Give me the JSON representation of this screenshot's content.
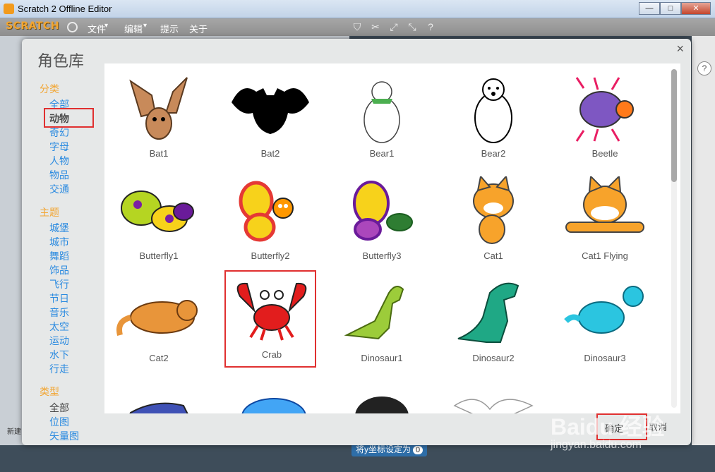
{
  "window": {
    "title": "Scratch 2 Offline Editor"
  },
  "menubar": {
    "logo": "SCRATCH",
    "items": [
      "文件",
      "编辑",
      "提示",
      "关于"
    ]
  },
  "dialog": {
    "title": "角色库",
    "close": "×",
    "category_heading": "分类",
    "categories": [
      "全部",
      "动物",
      "奇幻",
      "字母",
      "人物",
      "物品",
      "交通"
    ],
    "theme_heading": "主题",
    "themes": [
      "城堡",
      "城市",
      "舞蹈",
      "饰品",
      "飞行",
      "节日",
      "音乐",
      "太空",
      "运动",
      "水下",
      "行走"
    ],
    "type_heading": "类型",
    "types": [
      "全部",
      "位图",
      "矢量图"
    ],
    "sprites": [
      {
        "name": "Bat1"
      },
      {
        "name": "Bat2"
      },
      {
        "name": "Bear1"
      },
      {
        "name": "Bear2"
      },
      {
        "name": "Beetle"
      },
      {
        "name": "Butterfly1"
      },
      {
        "name": "Butterfly2"
      },
      {
        "name": "Butterfly3"
      },
      {
        "name": "Cat1"
      },
      {
        "name": "Cat1 Flying"
      },
      {
        "name": "Cat2"
      },
      {
        "name": "Crab"
      },
      {
        "name": "Dinosaur1"
      },
      {
        "name": "Dinosaur2"
      },
      {
        "name": "Dinosaur3"
      }
    ],
    "ok_label": "确定",
    "cancel_label": "取消"
  },
  "background": {
    "block_label": "将y坐标设定为",
    "block_value": "0",
    "new_label": "新建"
  },
  "watermark": {
    "brand": "Baidu 经验",
    "url": "jingyan.baidu.com"
  }
}
